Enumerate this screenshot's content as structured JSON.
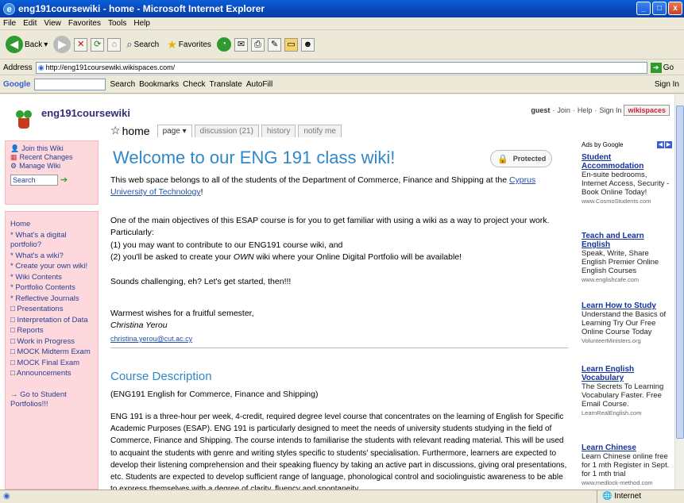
{
  "window": {
    "title": "eng191coursewiki - home - Microsoft Internet Explorer",
    "controls": [
      "_",
      "□",
      "x"
    ]
  },
  "menu": [
    "File",
    "Edit",
    "View",
    "Favorites",
    "Tools",
    "Help"
  ],
  "toolbar": {
    "back": "Back",
    "search": "Search",
    "favorites": "Favorites"
  },
  "address": {
    "label": "Address",
    "url": "http://eng191coursewiki.wikispaces.com/",
    "go": "Go"
  },
  "google": {
    "label": "Google",
    "search": "Search",
    "bookmarks": "Bookmarks",
    "check": "Check",
    "translate": "Translate",
    "autofill": "AutoFill",
    "signin": "Sign In"
  },
  "site": {
    "name": "eng191coursewiki"
  },
  "toplinks": {
    "guest": "guest",
    "join": "Join",
    "help": "Help",
    "signin": "Sign In",
    "wikispaces": "wikispaces"
  },
  "tabs": {
    "home": "home",
    "page": "page",
    "discussion": "discussion (21)",
    "history": "history",
    "notify": "notify me"
  },
  "sidebar1": {
    "join": "Join this Wiki",
    "recent": "Recent Changes",
    "manage": "Manage Wiki",
    "search_placeholder": "Search"
  },
  "nav": [
    "Home",
    "* What's a digital portfolio?",
    "* What's a wiki?",
    "* Create your own wiki!",
    "* Wiki Contents",
    "* Portfolio Contents",
    "* Reflective Journals",
    "□ Presentations",
    "□ Interpretation of Data",
    "□ Reports",
    "□ Work in Progress",
    "□ MOCK Midterm Exam",
    "□ MOCK Final Exam",
    "□ Announcements",
    "",
    "→ Go to Student Portfolios!!!"
  ],
  "main": {
    "heading": "Welcome to our ENG 191 class wiki!",
    "protected": "Protected",
    "intro_pre": "This web space belongs to all of the students of the Department of Commerce, Finance and Shipping at the ",
    "intro_link": "Cyprus University of Technology",
    "intro_post": "!",
    "objective": "One of the main objectives of this ESAP course is for you to get familiar with using a wiki as a way to project your work. Particularly:",
    "point1_pre": "(1) you may want to contribute to our ENG191 course wiki, and",
    "point2_pre": "(2) you'll be asked to create your ",
    "point2_em": "OWN",
    "point2_post": " wiki where your Online Digital Portfolio will be available!",
    "challenge": "Sounds challenging, eh? Let's get started, then!!!",
    "wishes": "Warmest wishes for a fruitful semester,",
    "signature": "Christina Yerou",
    "email": "christina.yerou@cut.ac.cy",
    "course_heading": "Course Description",
    "course_sub": "(ENG191 English for Commerce, Finance and Shipping)",
    "course_body": "ENG 191 is a three-hour per week, 4-credit, required degree level course that concentrates on the learning of English for Specific Academic Purposes (ESAP). ENG 191 is particularly designed to meet the needs of university students studying in the field of Commerce, Finance and Shipping. The course intends to familiarise the students with relevant reading material. This will be used to acquaint the students with genre and writing styles specific to students' specialisation. Furthermore, learners are expected to develop their listening comprehension and their speaking fluency by taking an active part in discussions, giving oral presentations, etc. Students are expected to develop sufficient range of language, phonological control and sociolinguistic awareness to be able to express themselves with a degree of clarity, fluency and spontaneity."
  },
  "ads": {
    "label": "Ads by Google",
    "items": [
      {
        "title": "Student Accommodation",
        "desc": "En-suite bedrooms, Internet Access, Security - Book Online Today!",
        "url": "www.CosmoStudents.com"
      },
      {
        "title": "Teach and Learn English",
        "desc": "Speak, Write, Share English Premier Online English Courses",
        "url": "www.englishcafe.com"
      },
      {
        "title": "Learn How to Study",
        "desc": "Understand the Basics of Learning Try Our Free Online Course Today",
        "url": "VolunteerMinisters.org"
      },
      {
        "title": "Learn English Vocabulary",
        "desc": "The Secrets To Learning Vocabulary Faster. Free Email Course.",
        "url": "LearnRealEnglish.com"
      },
      {
        "title": "Learn Chinese",
        "desc": "Learn Chinese online free for 1 mth Register in Sept. for 1 mth trial",
        "url": "www.medlock-method.com"
      }
    ]
  },
  "status": {
    "zone": "Internet"
  }
}
